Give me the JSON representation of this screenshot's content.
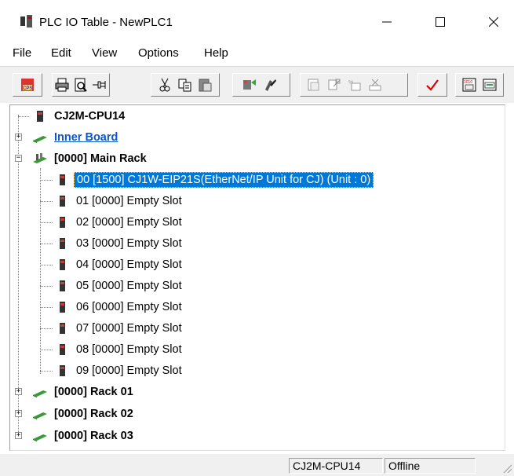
{
  "window": {
    "title": "PLC IO Table - NewPLC1",
    "min_icon": "minimize-icon",
    "max_icon": "maximize-icon",
    "close_icon": "close-icon"
  },
  "menu": {
    "file": "File",
    "edit": "Edit",
    "view": "View",
    "options": "Options",
    "help": "Help"
  },
  "toolbar": {
    "icons": [
      "cps-icon",
      "print-icon",
      "print-preview-icon",
      "pin-icon",
      "cut-icon",
      "copy-icon",
      "paste-icon",
      "transfer-icon",
      "compare-icon",
      "doc1-icon",
      "doc2-icon",
      "doc3-icon",
      "doc4-icon",
      "check-icon",
      "io-icon1",
      "io-icon2"
    ]
  },
  "tree": {
    "cpu": "CJ2M-CPU14",
    "inner_board": "Inner Board",
    "main_rack": "[0000] Main Rack",
    "slots": [
      "00 [1500] CJ1W-EIP21S(EtherNet/IP Unit for CJ) (Unit : 0)",
      "01 [0000] Empty Slot",
      "02 [0000] Empty Slot",
      "03 [0000] Empty Slot",
      "04 [0000] Empty Slot",
      "05 [0000] Empty Slot",
      "06 [0000] Empty Slot",
      "07 [0000] Empty Slot",
      "08 [0000] Empty Slot",
      "09 [0000] Empty Slot"
    ],
    "racks": [
      "[0000] Rack 01",
      "[0000] Rack 02",
      "[0000] Rack 03"
    ],
    "selected_index": 0
  },
  "status": {
    "model": "CJ2M-CPU14",
    "mode": "Offline"
  },
  "colors": {
    "selection": "#0078d7",
    "link": "#0b57d0",
    "rack_green": "#3a9a3a"
  }
}
